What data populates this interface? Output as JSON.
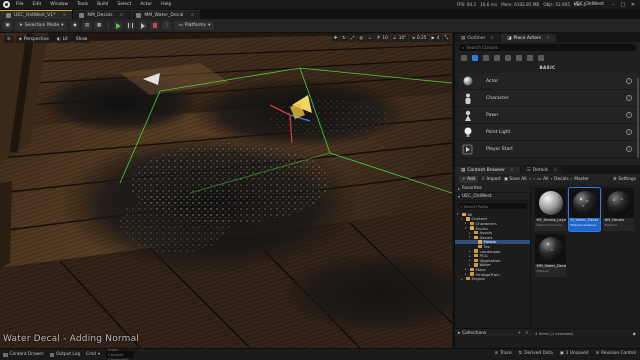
{
  "menu": {
    "items": [
      "File",
      "Edit",
      "Window",
      "Tools",
      "Build",
      "Select",
      "Actor",
      "Help"
    ],
    "stats": [
      "FPS: 94.2",
      "16.6 ms",
      "Mem: 6102.85 MB",
      "Objs: 52.905",
      "Kaf: 1"
    ],
    "project": "UEC_OldWest"
  },
  "tabs": [
    {
      "label": "UEC_OldWest_V1*"
    },
    {
      "label": "NM_Decals"
    },
    {
      "label": "MM_Water_Decal"
    }
  ],
  "toolbar": {
    "selection_mode": "Selection Mode",
    "platforms": "Platforms"
  },
  "viewport": {
    "perspective": "Perspective",
    "lit": "Lit",
    "show": "Show",
    "grid_snap": "10",
    "rot_snap": "10°",
    "scale_snap": "0.25",
    "cam_speed": "4",
    "caption": "Water Decal - Adding Normal"
  },
  "place_actors": {
    "tabs": [
      "Outliner",
      "Place Actors"
    ],
    "search_placeholder": "Search Classes",
    "category": "BASIC",
    "actors": [
      {
        "name": "Actor",
        "icon": "sphere-icon"
      },
      {
        "name": "Character",
        "icon": "character-icon"
      },
      {
        "name": "Pawn",
        "icon": "pawn-icon"
      },
      {
        "name": "Point Light",
        "icon": "light-bulb-icon"
      },
      {
        "name": "Player Start",
        "icon": "player-start-icon"
      }
    ]
  },
  "content_browser": {
    "tabs": [
      "Content Browser",
      "Details"
    ],
    "add": "Add",
    "import": "Import",
    "save_all": "Save All",
    "path": [
      "All",
      "Decals",
      "Master"
    ],
    "settings": "Settings",
    "favorites": "Favorites",
    "project": "UEC_OldWest",
    "search_placeholder": "Search Paths",
    "tree": [
      {
        "label": "All",
        "depth": 0,
        "open": true
      },
      {
        "label": "Content",
        "depth": 1,
        "open": true
      },
      {
        "label": "Characters",
        "depth": 2
      },
      {
        "label": "Enviro",
        "depth": 2,
        "open": true
      },
      {
        "label": "Assets",
        "depth": 3
      },
      {
        "label": "Decals",
        "depth": 3,
        "open": true
      },
      {
        "label": "Master",
        "depth": 4,
        "selected": true
      },
      {
        "label": "Tex",
        "depth": 4
      },
      {
        "label": "Landscape",
        "depth": 3
      },
      {
        "label": "PCG",
        "depth": 3
      },
      {
        "label": "Vegetation",
        "depth": 3
      },
      {
        "label": "Water",
        "depth": 3
      },
      {
        "label": "Maps",
        "depth": 2
      },
      {
        "label": "VintageTrain",
        "depth": 2
      },
      {
        "label": "Engine",
        "depth": 1
      }
    ],
    "collections": "Collections",
    "assets": [
      {
        "name": "MF_Decals_Layer",
        "type": "Material Function",
        "thumb": "sphere"
      },
      {
        "name": "M_Water_Decal",
        "type": "Material Instance",
        "thumb": "dark-sphere",
        "selected": true
      },
      {
        "name": "NM_Decals",
        "type": "Material",
        "thumb": "dark-sphere"
      },
      {
        "name": "MM_Water_Decal",
        "type": "Material",
        "thumb": "dark-sphere"
      }
    ],
    "footer": "4 items (1 selected)"
  },
  "statusbar": {
    "content_drawer": "Content Drawer",
    "output_log": "Output Log",
    "cmd": "Cmd",
    "cmd_placeholder": "Enter Console Command",
    "trace": "Trace",
    "derived_data": "Derived Data",
    "unsaved": "1 Unsaved",
    "revision_control": "Revision Control"
  },
  "colors": {
    "accent": "#e3a11b",
    "selection": "#2f7de0",
    "play": "#4fc34b"
  }
}
